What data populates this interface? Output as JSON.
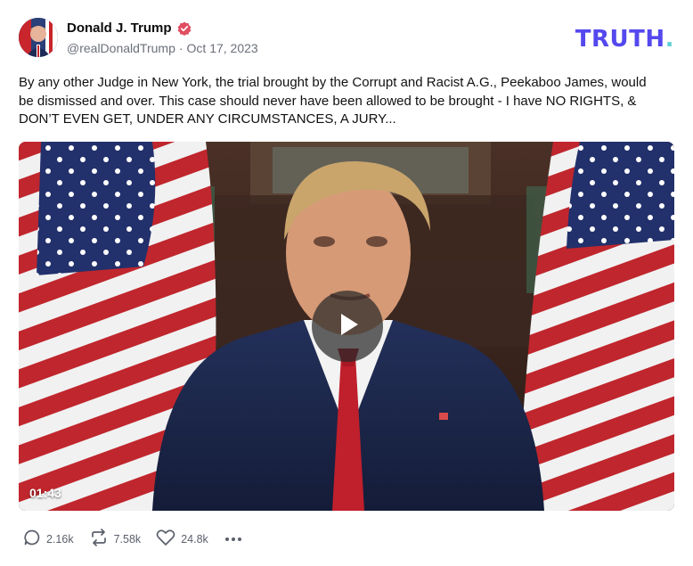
{
  "author": {
    "name": "Donald J. Trump",
    "handle": "@realDonaldTrump",
    "separator": "·",
    "date": "Oct 17, 2023",
    "verified_color": "#e14d61"
  },
  "brand": {
    "text": "TRUTH",
    "dot": ".",
    "color": "#5448ee",
    "dot_color": "#5fd1d3"
  },
  "post": {
    "text": "By any other Judge in New York, the trial brought by the Corrupt and Racist A.G., Peekaboo James, would be dismissed and over. This case should never have been allowed to be brought - I have NO RIGHTS, & DON’T EVEN GET, UNDER ANY CIRCUMSTANCES, A JURY..."
  },
  "video": {
    "duration": "01:43",
    "play_icon": "play-icon"
  },
  "actions": {
    "replies": {
      "count": "2.16k",
      "icon": "reply-icon"
    },
    "retruths": {
      "count": "7.58k",
      "icon": "repost-icon"
    },
    "likes": {
      "count": "24.8k",
      "icon": "heart-icon"
    },
    "more_icon": "more-dots-icon"
  }
}
